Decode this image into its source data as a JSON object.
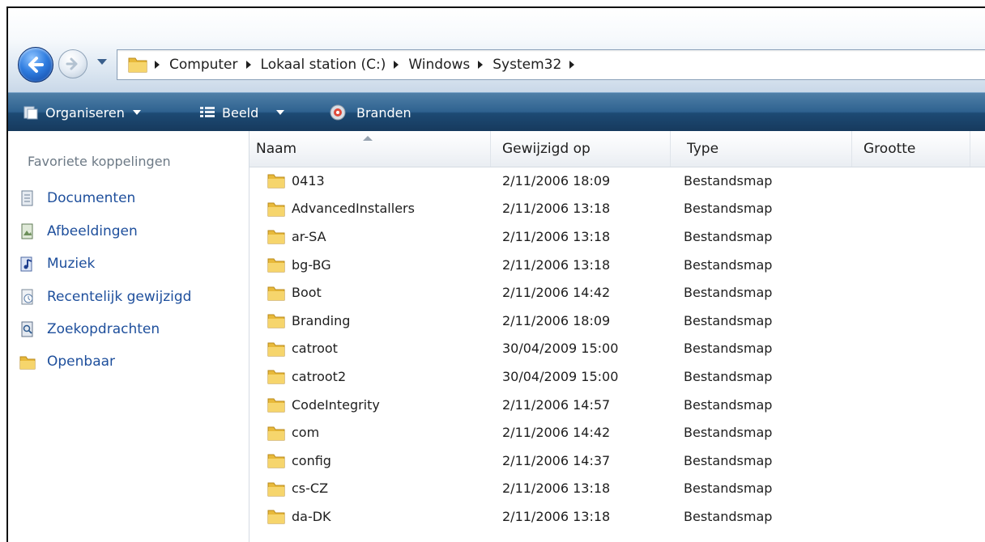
{
  "address": {
    "breadcrumbs": [
      "Computer",
      "Lokaal station (C:)",
      "Windows",
      "System32"
    ]
  },
  "toolbar": {
    "organize": "Organiseren",
    "view": "Beeld",
    "burn": "Branden"
  },
  "nav": {
    "title": "Favoriete koppelingen",
    "items": [
      {
        "label": "Documenten",
        "icon": "documents-icon"
      },
      {
        "label": "Afbeeldingen",
        "icon": "pictures-icon"
      },
      {
        "label": "Muziek",
        "icon": "music-icon"
      },
      {
        "label": "Recentelijk gewijzigd",
        "icon": "recent-icon"
      },
      {
        "label": "Zoekopdrachten",
        "icon": "searches-icon"
      },
      {
        "label": "Openbaar",
        "icon": "folder-icon"
      }
    ]
  },
  "columns": {
    "name": "Naam",
    "modified": "Gewijzigd op",
    "type": "Type",
    "size": "Grootte"
  },
  "files": [
    {
      "name": "0413",
      "modified": "2/11/2006 18:09",
      "type": "Bestandsmap"
    },
    {
      "name": "AdvancedInstallers",
      "modified": "2/11/2006 13:18",
      "type": "Bestandsmap"
    },
    {
      "name": "ar-SA",
      "modified": "2/11/2006 13:18",
      "type": "Bestandsmap"
    },
    {
      "name": "bg-BG",
      "modified": "2/11/2006 13:18",
      "type": "Bestandsmap"
    },
    {
      "name": "Boot",
      "modified": "2/11/2006 14:42",
      "type": "Bestandsmap"
    },
    {
      "name": "Branding",
      "modified": "2/11/2006 18:09",
      "type": "Bestandsmap"
    },
    {
      "name": "catroot",
      "modified": "30/04/2009 15:00",
      "type": "Bestandsmap"
    },
    {
      "name": "catroot2",
      "modified": "30/04/2009 15:00",
      "type": "Bestandsmap"
    },
    {
      "name": "CodeIntegrity",
      "modified": "2/11/2006 14:57",
      "type": "Bestandsmap"
    },
    {
      "name": "com",
      "modified": "2/11/2006 14:42",
      "type": "Bestandsmap"
    },
    {
      "name": "config",
      "modified": "2/11/2006 14:37",
      "type": "Bestandsmap"
    },
    {
      "name": "cs-CZ",
      "modified": "2/11/2006 13:18",
      "type": "Bestandsmap"
    },
    {
      "name": "da-DK",
      "modified": "2/11/2006 13:18",
      "type": "Bestandsmap"
    }
  ],
  "colors": {
    "link": "#1e4f9c",
    "toolbar": "#2f6290",
    "folder": "#e8b93a"
  }
}
